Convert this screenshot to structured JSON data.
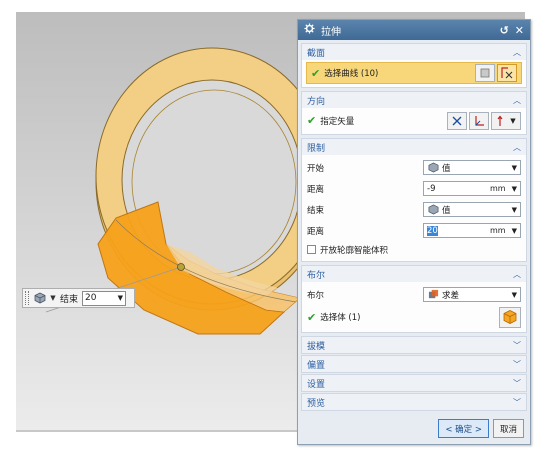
{
  "dialog": {
    "title": "拉伸",
    "sections": {
      "section": {
        "title": "截面",
        "select_curve_label": "选择曲线 (10)"
      },
      "direction": {
        "title": "方向",
        "vector_label": "指定矢量"
      },
      "limits": {
        "title": "限制",
        "start_label": "开始",
        "start_value_option": "值",
        "start_distance_label": "距离",
        "start_distance": "-9",
        "start_unit": "mm",
        "end_label": "结束",
        "end_value_option": "值",
        "end_distance_label": "距离",
        "end_distance": "20",
        "end_unit": "mm",
        "open_profile_label": "开放轮廓智能体积"
      },
      "boolean": {
        "title": "布尔",
        "boolean_label": "布尔",
        "boolean_option": "求差",
        "select_body_label": "选择体 (1)"
      },
      "draft": {
        "title": "拔模"
      },
      "offset": {
        "title": "偏置"
      },
      "settings": {
        "title": "设置"
      },
      "preview": {
        "title": "预览"
      }
    },
    "buttons": {
      "ok": "< 确定 >",
      "cancel": "取消"
    }
  },
  "mini_toolbar": {
    "end_label": "结束",
    "end_value": "20"
  },
  "colors": {
    "accent": "#3f6a95",
    "section_header": "#2e5fa0",
    "selection_highlight": "#f8d77a",
    "extrude_orange": "#f7a21b"
  }
}
